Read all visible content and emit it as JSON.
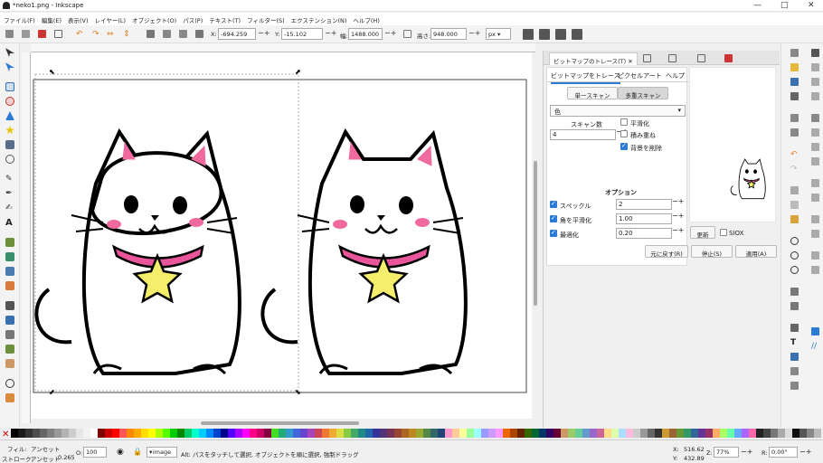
{
  "window": {
    "title": "*neko1.png - Inkscape",
    "min": "—",
    "max": "□",
    "close": "✕"
  },
  "menu": [
    "ファイル(F)",
    "編集(E)",
    "表示(V)",
    "レイヤー(L)",
    "オブジェクト(O)",
    "パス(P)",
    "テキスト(T)",
    "フィルター(S)",
    "エクステンション(N)",
    "ヘルプ(H)"
  ],
  "toolbar": {
    "x_label": "X:",
    "x_value": "-694.259",
    "y_label": "Y:",
    "y_value": "-15.102",
    "w_label": "幅:",
    "w_value": "1488.000",
    "h_label": "高さ:",
    "h_value": "948.000",
    "unit": "px"
  },
  "dock": {
    "panel_tab": "ビットマップのトレース(T)",
    "subtabs": [
      "ビットマップをトレース",
      "ピクセルアート",
      "ヘルプ"
    ],
    "scan_single": "単一スキャン",
    "scan_multi": "多重スキャン",
    "mode_select": "色",
    "scans_label": "スキャン数",
    "scans_value": "4",
    "smooth_label": "平滑化",
    "stack_label": "積み重ね",
    "remove_bg_label": "背景を削除",
    "options_title": "オプション",
    "speckles_label": "スペックル",
    "speckles_value": "2",
    "corners_label": "角を平滑化",
    "corners_value": "1.00",
    "optimize_label": "最適化",
    "optimize_value": "0.20",
    "update_button": "更新",
    "siox_label": "SIOX",
    "reset_button": "元に戻す(R)",
    "stop_button": "停止(S)",
    "apply_button": "適用(A)"
  },
  "status": {
    "fill_label": "フィル:",
    "fill_value": "アンセット",
    "stroke_label": "ストローク:",
    "stroke_value": "アンセット",
    "stroke_width": "0.265",
    "opacity_label": "O:",
    "opacity_value": "100",
    "layer": "•image",
    "message": "Alt: パスをタッチして選択, オブジェクトを順に選択, 強制ドラッグ",
    "x_label": "X:",
    "x_value": "516.62",
    "y_label": "Y:",
    "y_value": "432.89",
    "zoom_label": "Z:",
    "zoom_value": "77%",
    "rot_label": "R:",
    "rot_value": "0.00°"
  },
  "colors": {
    "accent": "#2a7bd5",
    "collar": "#e8559a",
    "star": "#f4ee6a",
    "ear": "#f06aa0"
  }
}
